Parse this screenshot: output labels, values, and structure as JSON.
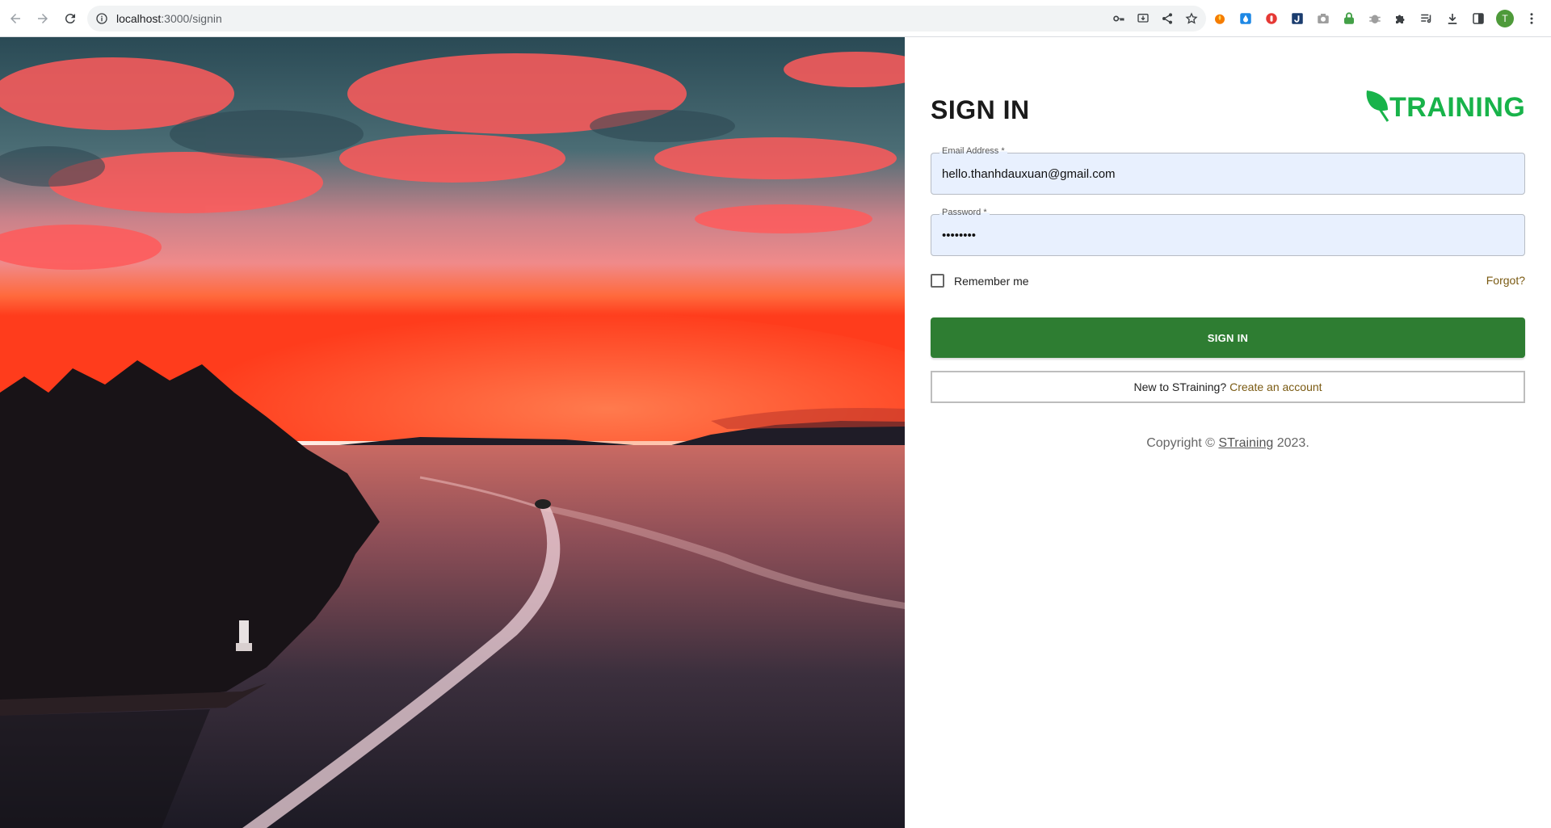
{
  "browser": {
    "url_host": "localhost",
    "url_path": ":3000/signin",
    "avatar_initial": "T",
    "extension_icons": [
      "fire-extension-icon",
      "drop-extension-icon",
      "red-shield-extension-icon",
      "blue-j-extension-icon",
      "camera-extension-icon",
      "green-lock-extension-icon",
      "bug-extension-icon",
      "puzzle-icon",
      "media-list-icon",
      "download-icon",
      "sidebar-icon"
    ]
  },
  "signin": {
    "title": "SIGN IN",
    "logo_text": "TRAINING",
    "email": {
      "label": "Email Address *",
      "value": "hello.thanhdauxuan@gmail.com"
    },
    "password": {
      "label": "Password *",
      "value": "••••••••"
    },
    "remember_label": "Remember me",
    "forgot_label": "Forgot?",
    "submit_label": "SIGN IN",
    "new_account_prefix": "New to STraining?",
    "create_account_label": "Create an account",
    "copyright_prefix": "Copyright ©",
    "copyright_brand": "STraining",
    "copyright_suffix": "2023."
  },
  "colors": {
    "primary_button": "#2e7d32",
    "logo_green": "#18b34a",
    "link_brown": "#7a5a12",
    "autofill_bg": "#e8f0fe"
  }
}
